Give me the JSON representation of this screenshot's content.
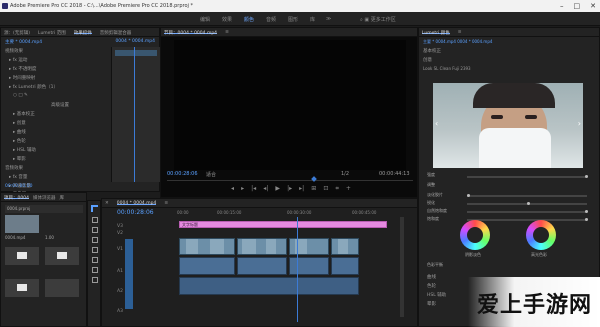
{
  "app": {
    "title": "Adobe Premiere Pro CC 2018 - C:\\...\\Adobe Premiere Pro CC 2018.prproj *",
    "window_buttons": [
      "–",
      "□",
      "✕"
    ]
  },
  "menu": {
    "items": [
      "编辑",
      "效果",
      "颜色",
      "音频",
      "图形",
      "库",
      "≫"
    ],
    "active_index": 2,
    "right_label": "⌕  ▣ 更多工作区"
  },
  "left_panel": {
    "tabs": [
      "源：(无剪辑)",
      "Lumetri 范围",
      "效果控件",
      "音频剪辑混合器"
    ],
    "active_tab_index": 2,
    "header_left": "主要 * 0004.mp4",
    "header_right": "0004 * 0004.mp4",
    "rows": [
      "视频效果",
      "▸ fx 运动",
      "▸ fx 不透明度",
      "▸ 时间重映射",
      "▸ fx Lumetri 颜色（1）",
      "○ □ ✎",
      "高级设置",
      "▸ 基本校正",
      "▸ 创意",
      "▸ 曲线",
      "▸ 色轮",
      "▸ HSL 辅助",
      "▸ 晕影",
      "音频效果",
      "▸ fx 音量",
      "▸ 声道音量",
      "▸ 声像器"
    ],
    "timecode": "00:00:00:00"
  },
  "program_monitor": {
    "tabs": [
      "节目：0004 * 0004.mp4",
      "≡"
    ],
    "timecode_left": "00:00:28:06",
    "fit_label": "适合",
    "fraction": "1/2",
    "timecode_right": "00:00:44:13",
    "transport": [
      "◂",
      "▸",
      "|◂",
      "◂|",
      "▶",
      "|▸",
      "▸|",
      "⊞",
      "⊡",
      "⌗",
      "+"
    ]
  },
  "project_panel": {
    "tabs": [
      "项目：0004",
      "媒体浏览器",
      "库",
      "信息",
      "效果"
    ],
    "bin_name": "0004.prproj",
    "items": [
      {
        "name": "0004.mp4",
        "duration": ""
      },
      {
        "name": "0004.mp4",
        "duration": "1.00"
      },
      {
        "name": "",
        "duration": ""
      },
      {
        "name": "",
        "duration": ""
      }
    ]
  },
  "timeline": {
    "tabs": [
      "0004 * 0004.mp4",
      "≡"
    ],
    "timecode": "00:00:28:06",
    "ruler": [
      "00:00",
      "00:00:15:00",
      "00:00:30:00",
      "00:00:45:00"
    ],
    "track_labels": [
      "V3",
      "V2",
      "V1",
      "A1",
      "A2",
      "A3"
    ],
    "title_clip": "文字标题"
  },
  "lumetri": {
    "tabs": [
      "Lumetri 颜色",
      "≡"
    ],
    "header": "主要 * 0004.mp4  0004 * 0004.mp4",
    "section_basic": "基本校正",
    "section_creative": "创意",
    "look_label": "Look  SL Clean Fuji 2393",
    "sliders": [
      "强度",
      "调整",
      "淡化胶片",
      "锐化",
      "自然饱和度",
      "饱和度"
    ],
    "wheel_labels": [
      "阴影淡色",
      "高光色彩"
    ],
    "color_balance": "色彩平衡",
    "sections_bottom": [
      "曲线",
      "色轮",
      "HSL 辅助",
      "晕影"
    ]
  },
  "watermark": {
    "text": "爱上手游网"
  }
}
